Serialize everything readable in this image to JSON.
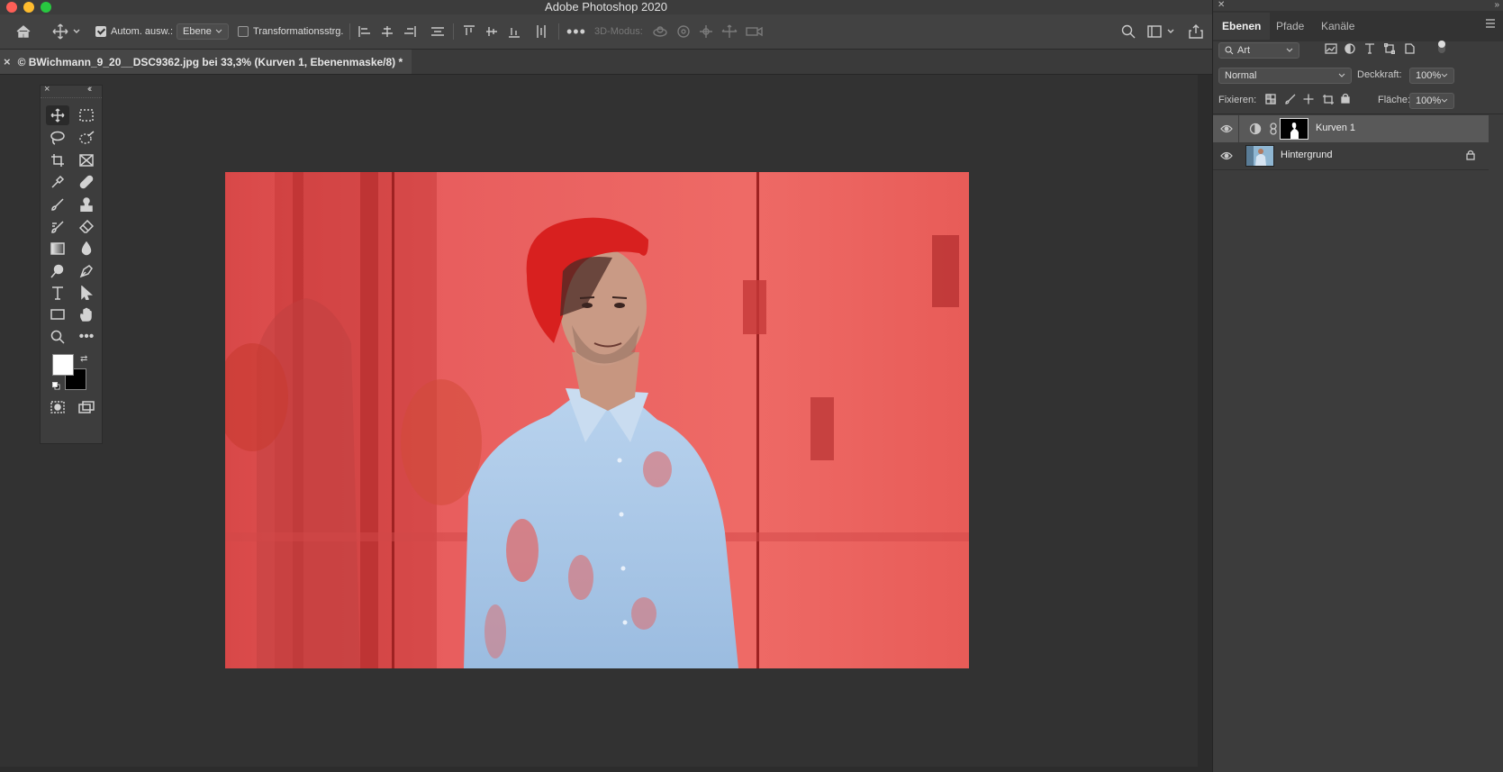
{
  "window": {
    "title": "Adobe Photoshop 2020"
  },
  "options_bar": {
    "auto_select_label": "Autom. ausw.:",
    "auto_select_checked": true,
    "auto_select_target": "Ebene",
    "transform_controls_label": "Transformationsstrg.",
    "transform_controls_checked": false,
    "mode_3d_label": "3D-Modus:"
  },
  "document_tab": {
    "close_glyph": "×",
    "title": "© BWichmann_9_20__DSC9362.jpg bei 33,3% (Kurven 1, Ebenenmaske/8) *"
  },
  "tools_panel": {
    "close_glyph": "×",
    "collapse_glyph": "‹‹",
    "foreground_color": "#ffffff",
    "background_color": "#000000"
  },
  "layers_panel": {
    "tabs": [
      "Ebenen",
      "Pfade",
      "Kanäle"
    ],
    "active_tab": "Ebenen",
    "filter_kind": "Art",
    "blend_mode": "Normal",
    "opacity_label": "Deckkraft:",
    "opacity_value": "100%",
    "lock_label": "Fixieren:",
    "fill_label": "Fläche:",
    "fill_value": "100%",
    "layers": [
      {
        "name": "Kurven 1",
        "type": "adjustment-curves",
        "visible": true,
        "selected": true,
        "has_mask": true
      },
      {
        "name": "Hintergrund",
        "type": "pixel",
        "visible": true,
        "selected": false,
        "locked": true
      }
    ]
  },
  "colors": {
    "quick_mask_overlay": "#e35c5c",
    "app_bg": "#323232",
    "panel_bg": "#3c3c3c"
  }
}
